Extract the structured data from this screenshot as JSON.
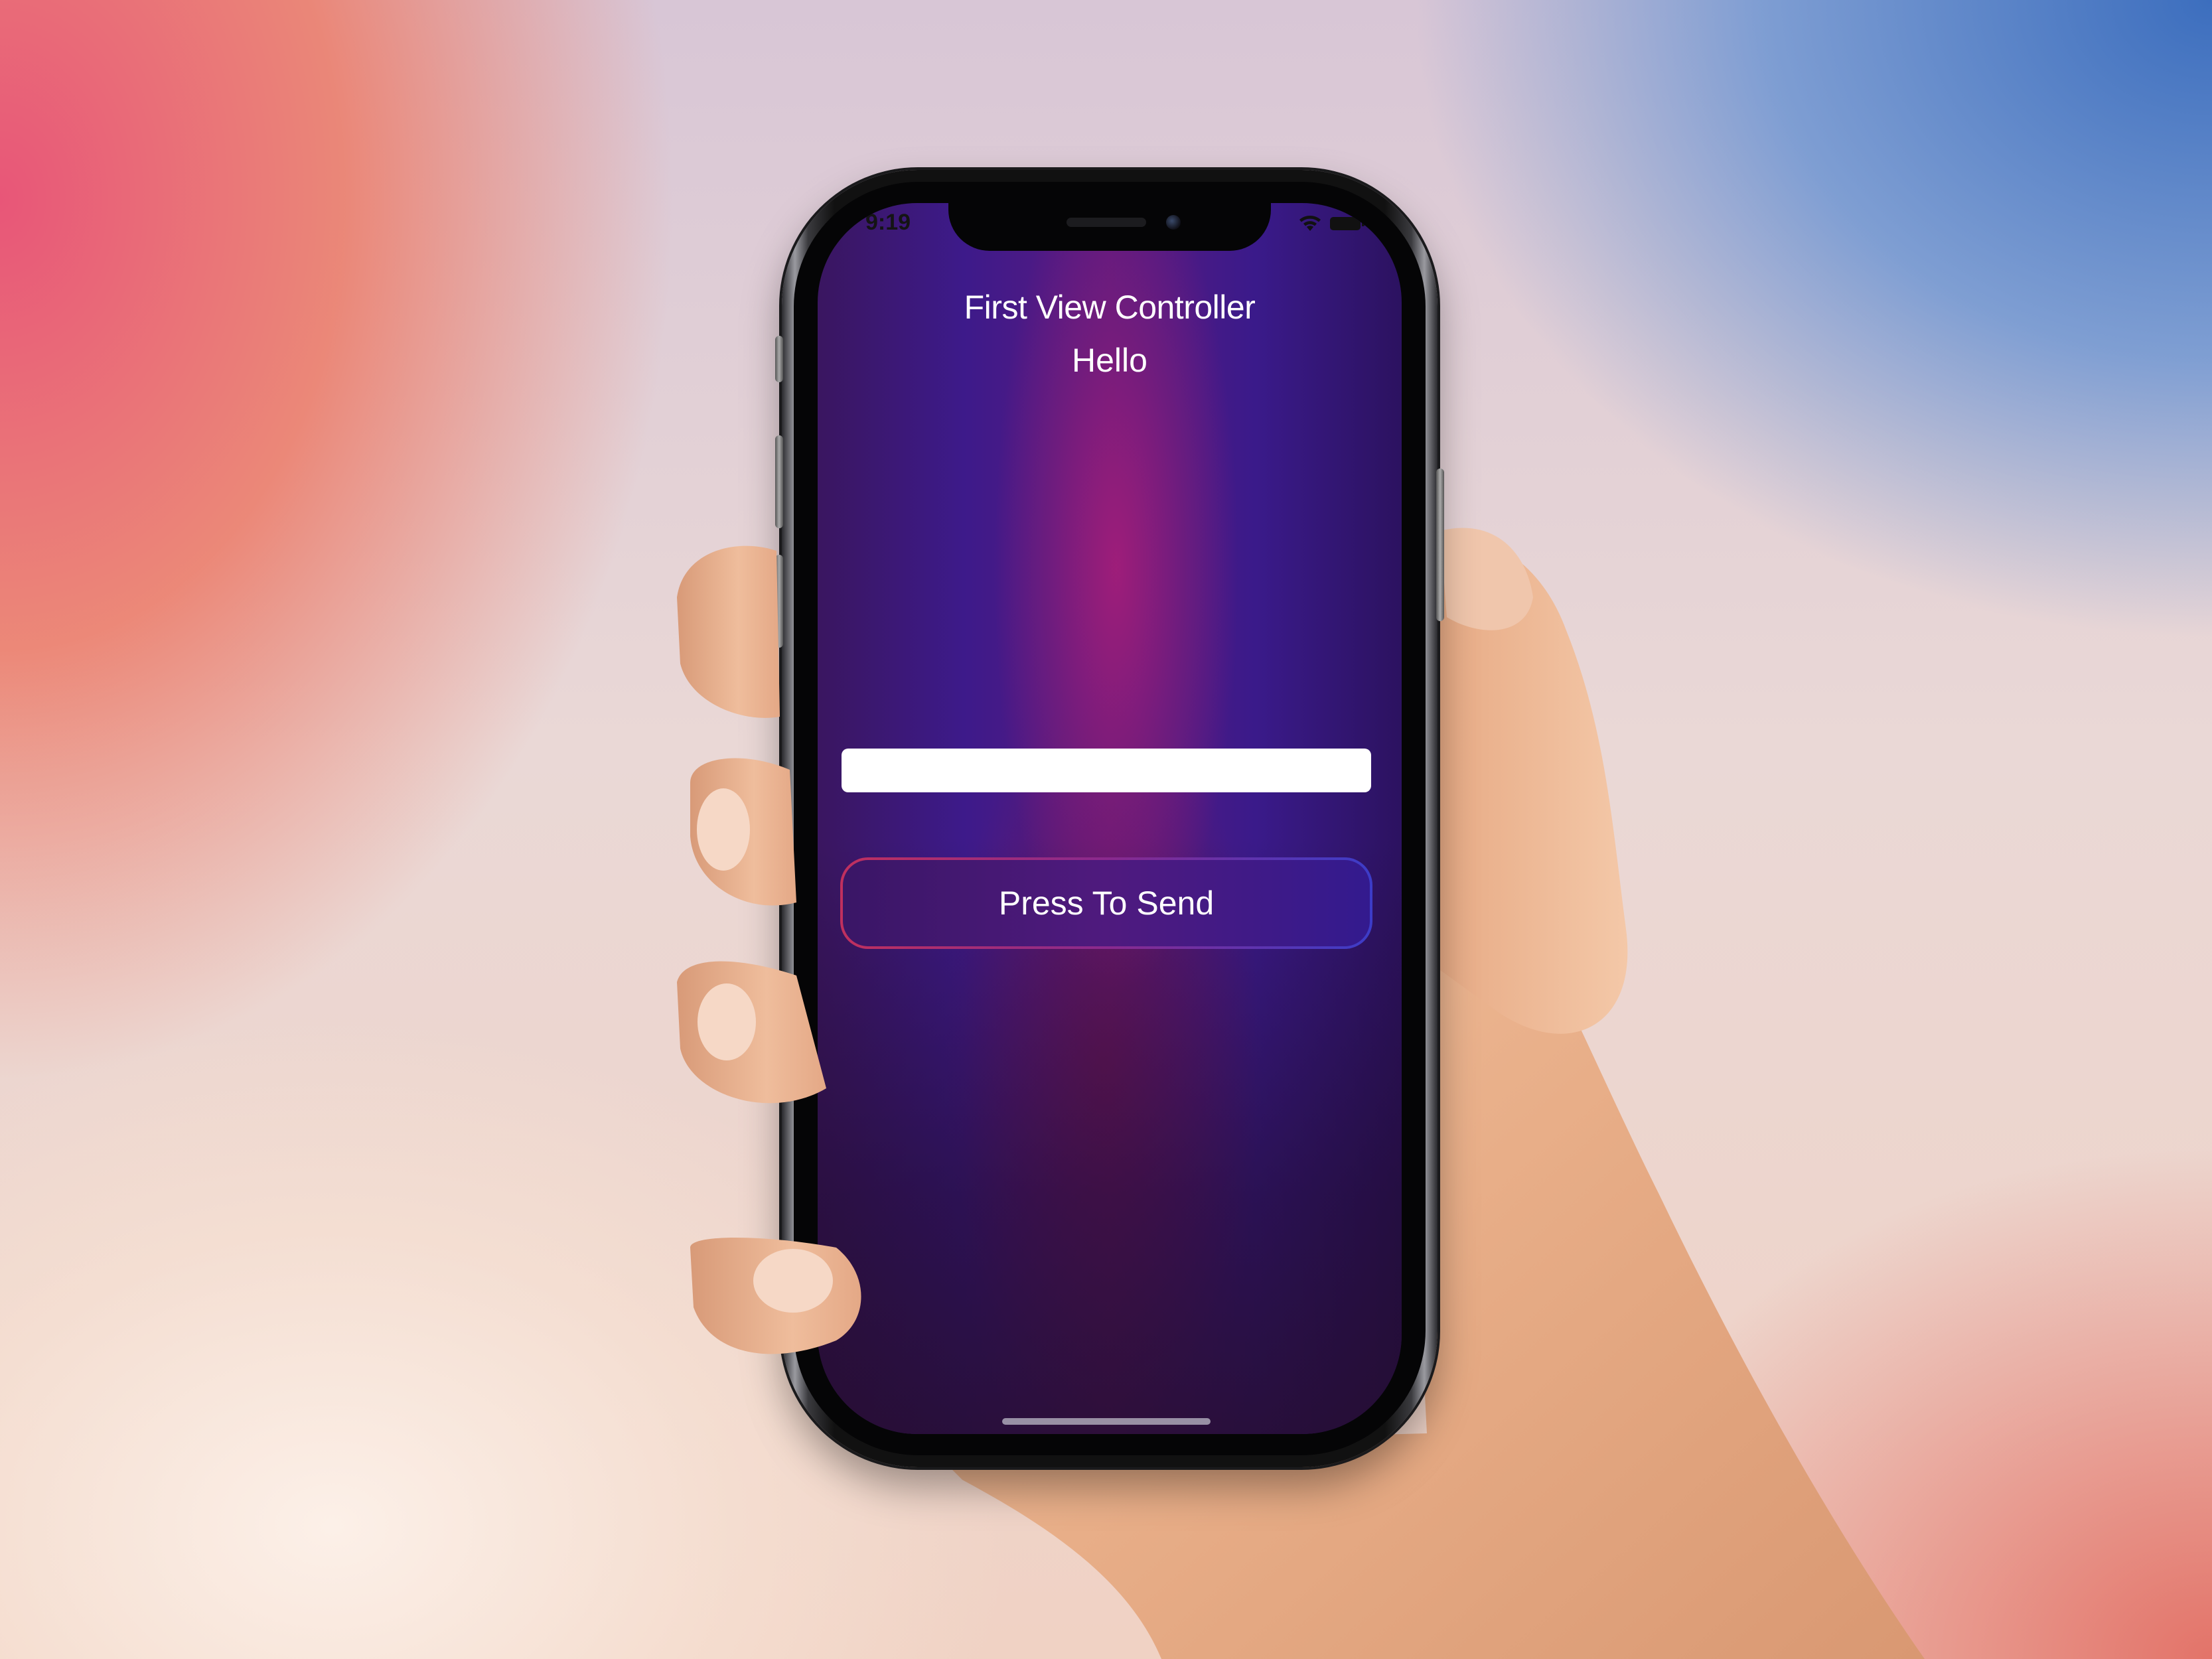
{
  "status_bar": {
    "time": "9:19",
    "icons": [
      "wifi-icon",
      "battery-icon"
    ]
  },
  "screen": {
    "title": "First View Controller",
    "label": "Hello",
    "input": {
      "value": "",
      "placeholder": ""
    },
    "send_button_label": "Press To Send"
  },
  "colors": {
    "button_border_start": "#c0305e",
    "button_border_end": "#3c3cc8",
    "screen_background": "#3d1a8a",
    "text": "#ffffff"
  }
}
